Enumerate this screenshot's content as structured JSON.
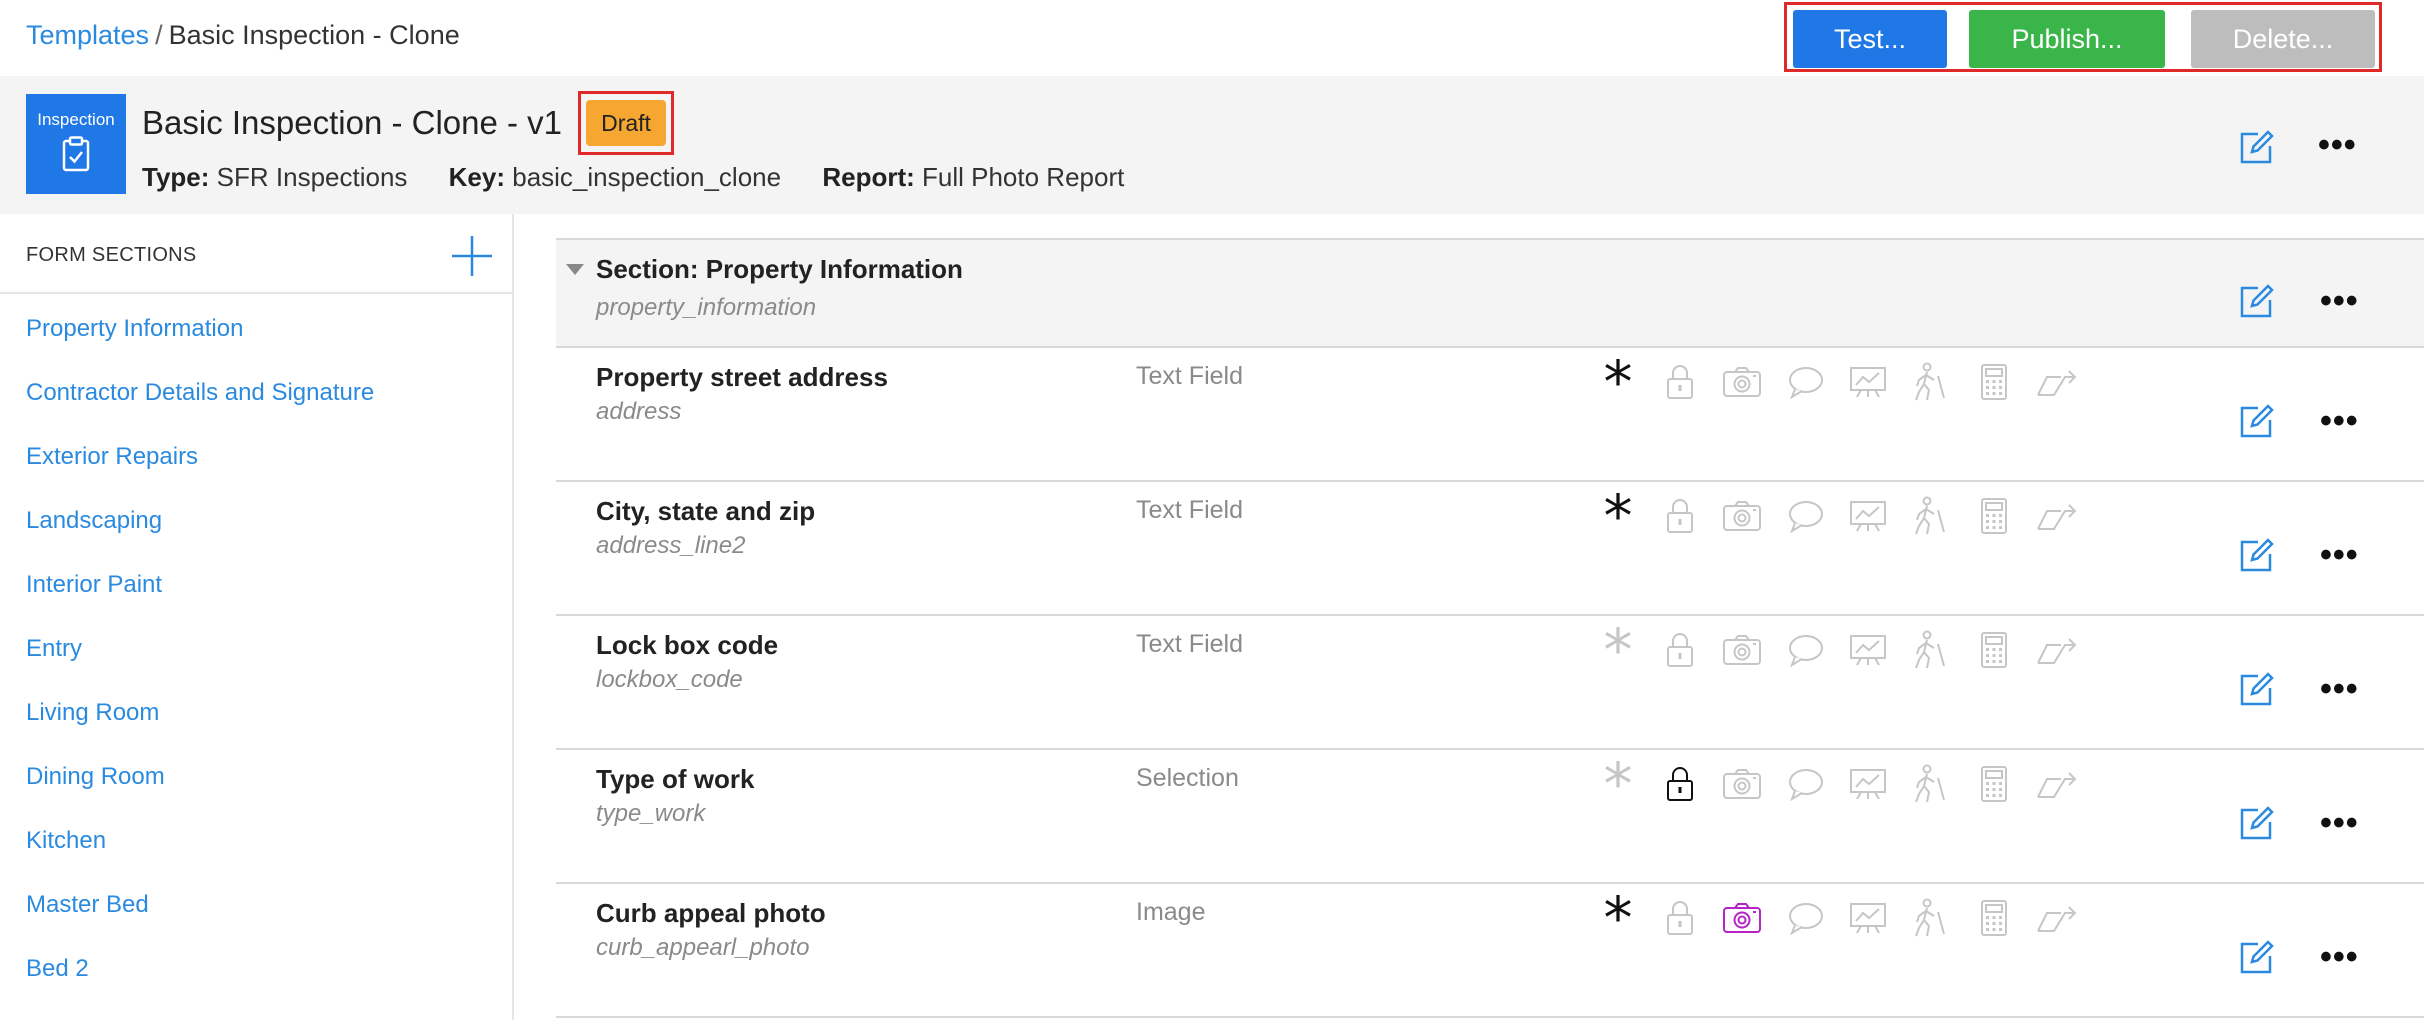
{
  "breadcrumb": {
    "root": "Templates",
    "separator": "/",
    "current": "Basic Inspection - Clone"
  },
  "actions": {
    "test": "Test...",
    "publish": "Publish...",
    "delete": "Delete..."
  },
  "template": {
    "icon_label": "Inspection",
    "title": "Basic Inspection - Clone - v1",
    "status": "Draft",
    "type_label": "Type:",
    "type_value": "SFR Inspections",
    "key_label": "Key:",
    "key_value": "basic_inspection_clone",
    "report_label": "Report:",
    "report_value": "Full Photo Report"
  },
  "sidebar": {
    "heading": "FORM SECTIONS",
    "items": [
      {
        "label": "Property Information"
      },
      {
        "label": "Contractor Details and Signature"
      },
      {
        "label": "Exterior Repairs"
      },
      {
        "label": "Landscaping"
      },
      {
        "label": "Interior Paint"
      },
      {
        "label": "Entry"
      },
      {
        "label": "Living Room"
      },
      {
        "label": "Dining Room"
      },
      {
        "label": "Kitchen"
      },
      {
        "label": "Master Bed"
      },
      {
        "label": "Bed 2"
      }
    ]
  },
  "section": {
    "title": "Section: Property Information",
    "key": "property_information"
  },
  "fields": [
    {
      "name": "Property street address",
      "key": "address",
      "type": "Text Field",
      "required": true,
      "locked": false,
      "photo": false
    },
    {
      "name": "City, state and zip",
      "key": "address_line2",
      "type": "Text Field",
      "required": true,
      "locked": false,
      "photo": false
    },
    {
      "name": "Lock box code",
      "key": "lockbox_code",
      "type": "Text Field",
      "required": false,
      "locked": false,
      "photo": false
    },
    {
      "name": "Type of work",
      "key": "type_work",
      "type": "Selection",
      "required": false,
      "locked": true,
      "photo": false
    },
    {
      "name": "Curb appeal photo",
      "key": "curb_appearl_photo",
      "type": "Image",
      "required": true,
      "locked": false,
      "photo": true
    }
  ],
  "icon_names": [
    "required-star-icon",
    "lock-icon",
    "camera-icon",
    "comment-icon",
    "chart-icon",
    "inspector-icon",
    "calculator-icon",
    "flag-icon"
  ],
  "colors": {
    "link": "#2a8adf",
    "primary": "#1f78e6",
    "publish": "#39b54a",
    "disabled": "#bdbdbd",
    "draft": "#f5a731",
    "highlight": "#e02a2a",
    "photo_active": "#b523c9",
    "icon_inactive": "#c6c6c6"
  }
}
